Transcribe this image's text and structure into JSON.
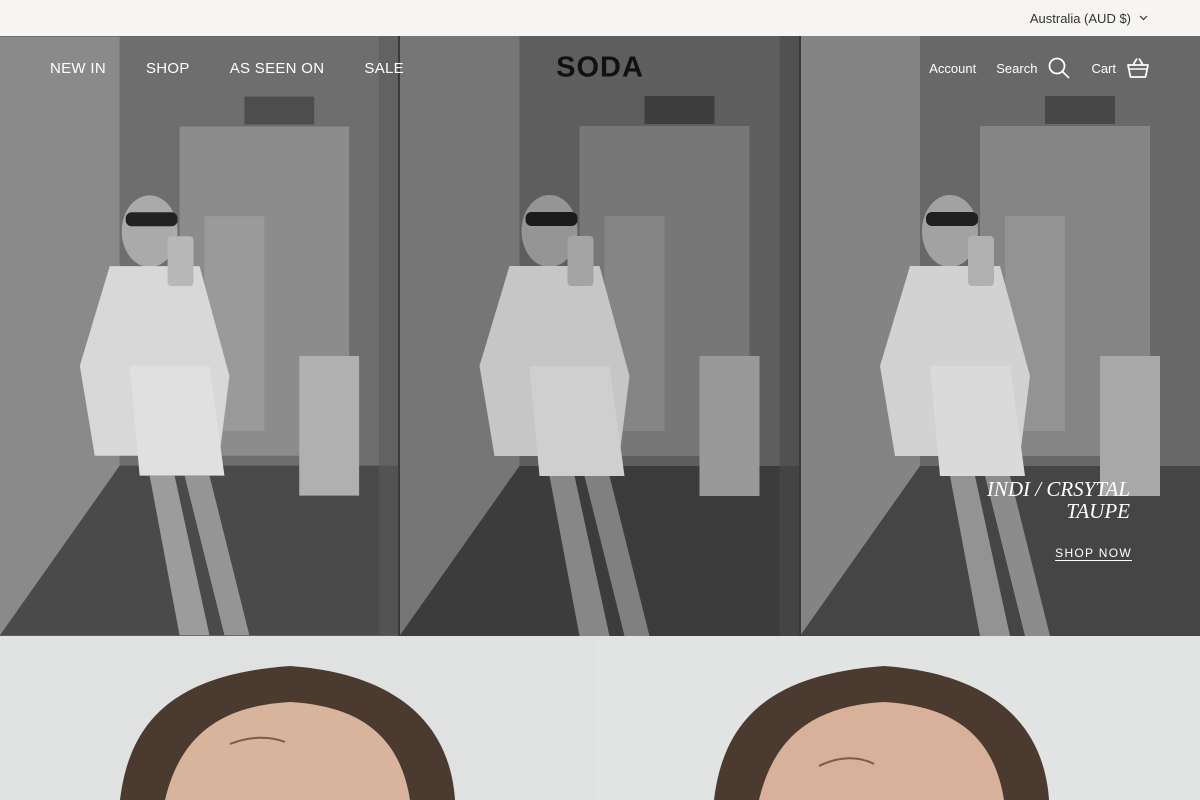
{
  "topbar": {
    "currency_label": "Australia (AUD $)"
  },
  "nav": {
    "links": [
      "NEW IN",
      "SHOP",
      "AS SEEN ON",
      "SALE"
    ],
    "logo": "SODA",
    "account_label": "Account",
    "search_label": "Search",
    "cart_label": "Cart"
  },
  "hero": {
    "title": "INDI / CRSYTAL TAUPE",
    "cta": "SHOP NOW"
  },
  "colors": {
    "topbar_bg": "#f6f5f1",
    "hero_tint": "#5f5f5f",
    "lower_bg": "#dfe2e0"
  },
  "icons": {
    "currency": "chevron-down-icon",
    "search": "search-icon",
    "cart": "basket-icon"
  }
}
